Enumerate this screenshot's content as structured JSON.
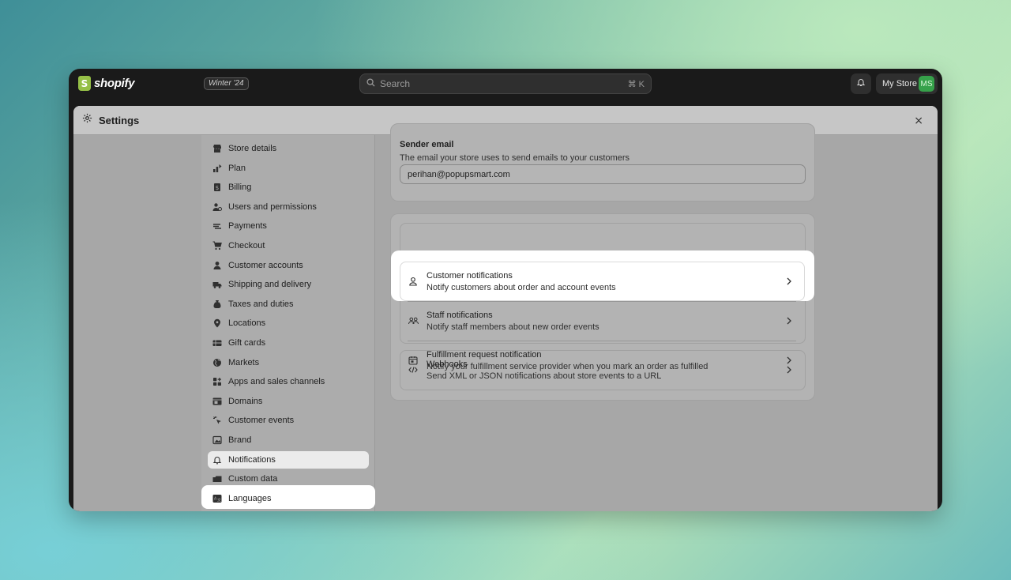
{
  "topbar": {
    "logo_letter": "S",
    "logo_text": "shopify",
    "edition_badge": "Winter '24",
    "search_placeholder": "Search",
    "search_shortcut": "⌘ K",
    "store_name": "My Store",
    "avatar_initials": "MS"
  },
  "modal": {
    "title": "Settings",
    "close_label": "×"
  },
  "sidebar": {
    "items": [
      {
        "label": "Store details",
        "icon": "store-icon"
      },
      {
        "label": "Plan",
        "icon": "plan-icon"
      },
      {
        "label": "Billing",
        "icon": "billing-icon"
      },
      {
        "label": "Users and permissions",
        "icon": "users-icon"
      },
      {
        "label": "Payments",
        "icon": "payments-icon"
      },
      {
        "label": "Checkout",
        "icon": "cart-icon"
      },
      {
        "label": "Customer accounts",
        "icon": "person-icon"
      },
      {
        "label": "Shipping and delivery",
        "icon": "truck-icon"
      },
      {
        "label": "Taxes and duties",
        "icon": "taxes-icon"
      },
      {
        "label": "Locations",
        "icon": "location-icon"
      },
      {
        "label": "Gift cards",
        "icon": "gift-card-icon"
      },
      {
        "label": "Markets",
        "icon": "globe-icon"
      },
      {
        "label": "Apps and sales channels",
        "icon": "apps-icon"
      },
      {
        "label": "Domains",
        "icon": "domains-icon"
      },
      {
        "label": "Customer events",
        "icon": "events-icon"
      },
      {
        "label": "Brand",
        "icon": "brand-icon"
      },
      {
        "label": "Notifications",
        "icon": "bell-icon",
        "active": true
      },
      {
        "label": "Custom data",
        "icon": "custom-data-icon"
      },
      {
        "label": "Languages",
        "icon": "languages-icon"
      }
    ]
  },
  "sender": {
    "title": "Sender email",
    "description": "The email your store uses to send emails to your customers",
    "email_value": "perihan@popupsmart.com"
  },
  "notifications": [
    {
      "title": "Customer notifications",
      "description": "Notify customers about order and account events",
      "icon": "person-outline-icon"
    },
    {
      "title": "Staff notifications",
      "description": "Notify staff members about new order events",
      "icon": "staff-icon"
    },
    {
      "title": "Fulfillment request notification",
      "description": "Notify your fulfillment service provider when you mark an order as fulfilled",
      "icon": "calendar-icon"
    }
  ],
  "webhooks": {
    "title": "Webhooks",
    "description": "Send XML or JSON notifications about store events to a URL",
    "icon": "code-icon"
  },
  "colors": {
    "topbar_bg": "#1a1a1a",
    "avatar_green": "#36a14a",
    "logo_green": "#95bf47"
  }
}
